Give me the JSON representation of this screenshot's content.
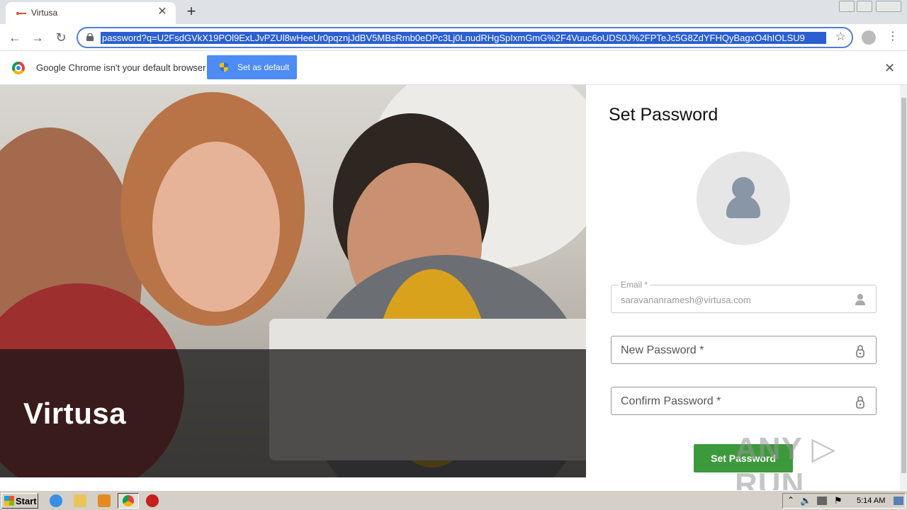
{
  "browser": {
    "tab_title": "Virtusa",
    "tab_close": "✕",
    "new_tab": "+",
    "back": "←",
    "forward": "→",
    "reload": "↻",
    "url": "password?q=U2FsdGVkX19POl9ExLJvPZUl8wHeeUr0pqznjJdBV5MBsRmb0eDPc3Lj0LnudRHgSpIxmGmG%2F4Vuuc6oUDS0J%2FPTeJc5G8ZdYFHQyBagxO4hIOLSU9",
    "star": "☆",
    "menu": "⋮"
  },
  "infobar": {
    "message": "Google Chrome isn't your default browser",
    "button": "Set as default",
    "close": "✕"
  },
  "hero": {
    "brand": "Virtusa"
  },
  "form": {
    "title": "Set Password",
    "email_label": "Email *",
    "email_value": "saravananramesh@virtusa.com",
    "new_password_placeholder": "New Password *",
    "confirm_password_placeholder": "Confirm Password *",
    "submit": "Set Password"
  },
  "watermark": "ANY ▷ RUN",
  "taskbar": {
    "start": "Start",
    "clock": "5:14 AM"
  },
  "colors": {
    "accent_blue": "#4d8cf4",
    "submit_green": "#3c9a3c",
    "url_highlight": "#2b5fd1"
  }
}
